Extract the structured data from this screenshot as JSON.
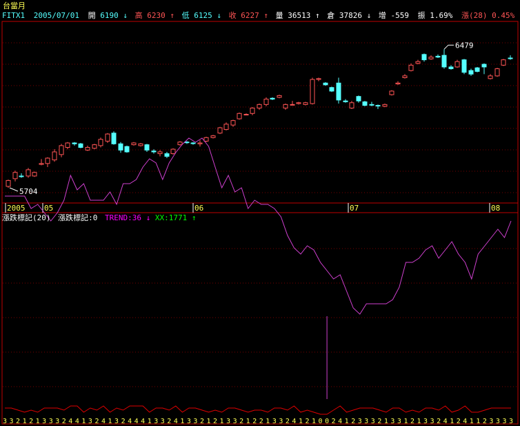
{
  "window": {
    "title": "台當月",
    "symbol": "FITX1",
    "date": "2005/07/01"
  },
  "quote": {
    "open_label": "開",
    "open": "6190",
    "open_arrow": "↓",
    "high_label": "高",
    "high": "6230",
    "high_arrow": "↑",
    "low_label": "低",
    "low": "6125",
    "low_arrow": "↓",
    "close_label": "收",
    "close": "6227",
    "close_arrow": "↑",
    "volume_label": "量",
    "volume": "36513",
    "volume_arrow": "↑",
    "oi_label": "倉",
    "oi": "37826",
    "oi_arrow": "↓",
    "change_label": "增",
    "change": "-559",
    "amp_label": "振",
    "amp": "1.69%",
    "rise_label": "漲(28)",
    "rise": "0.45%"
  },
  "indicator": {
    "name": "漲跌標記(20)",
    "name2": "漲跌標記:0",
    "trend_label": "TREND:36",
    "trend_arrow": "↓",
    "xx_label": "XX:1771",
    "xx_arrow": "↑"
  },
  "colors": {
    "background": "#000000",
    "up": "#ff5555",
    "down": "#55ffff",
    "panel_border": "#c00000",
    "grid": "#7a0000",
    "trend": "#d040d0",
    "spike": "#d040d0",
    "bottom_line": "#e00000",
    "xaxis_text": "#ffff55",
    "title_text": "#ffff55",
    "header_text": "#ffffff",
    "green": "#00ff00",
    "magenta": "#ff00ff"
  },
  "chart_data": [
    {
      "type": "candlestick",
      "title": "台當月",
      "x_tick_labels": [
        "2005",
        "05",
        "06",
        "07",
        "08"
      ],
      "annotations": [
        {
          "text": "5704",
          "value": 5704
        },
        {
          "text": "6479",
          "value": 6479
        }
      ],
      "ylim": [
        5650,
        6600
      ],
      "candles": [
        {
          "o": 5745,
          "c": 5712,
          "h": 5750,
          "l": 5704,
          "dir": "up"
        },
        {
          "o": 5755,
          "c": 5790,
          "h": 5800,
          "l": 5740,
          "dir": "up"
        },
        {
          "o": 5770,
          "c": 5770,
          "h": 5785,
          "l": 5760,
          "dir": "down"
        },
        {
          "o": 5770,
          "c": 5805,
          "h": 5815,
          "l": 5760,
          "dir": "up"
        },
        {
          "o": 5790,
          "c": 5770,
          "h": 5795,
          "l": 5765,
          "dir": "up"
        },
        {
          "o": 5840,
          "c": 5835,
          "h": 5865,
          "l": 5830,
          "dir": "up"
        },
        {
          "o": 5840,
          "c": 5870,
          "h": 5875,
          "l": 5820,
          "dir": "up"
        },
        {
          "o": 5860,
          "c": 5905,
          "h": 5920,
          "l": 5850,
          "dir": "up"
        },
        {
          "o": 5890,
          "c": 5940,
          "h": 5950,
          "l": 5875,
          "dir": "up"
        },
        {
          "o": 5930,
          "c": 5955,
          "h": 5960,
          "l": 5920,
          "dir": "up"
        },
        {
          "o": 5955,
          "c": 5950,
          "h": 5960,
          "l": 5940,
          "dir": "down"
        },
        {
          "o": 5950,
          "c": 5930,
          "h": 5955,
          "l": 5925,
          "dir": "down"
        },
        {
          "o": 5915,
          "c": 5930,
          "h": 5940,
          "l": 5910,
          "dir": "up"
        },
        {
          "o": 5925,
          "c": 5945,
          "h": 5950,
          "l": 5920,
          "dir": "up"
        },
        {
          "o": 5940,
          "c": 5975,
          "h": 5985,
          "l": 5930,
          "dir": "up"
        },
        {
          "o": 5965,
          "c": 6005,
          "h": 6010,
          "l": 5955,
          "dir": "up"
        },
        {
          "o": 6010,
          "c": 5950,
          "h": 6020,
          "l": 5945,
          "dir": "down"
        },
        {
          "o": 5950,
          "c": 5915,
          "h": 5960,
          "l": 5900,
          "dir": "down"
        },
        {
          "o": 5935,
          "c": 5905,
          "h": 5940,
          "l": 5900,
          "dir": "down"
        },
        {
          "o": 5955,
          "c": 5945,
          "h": 5960,
          "l": 5940,
          "dir": "up"
        },
        {
          "o": 5940,
          "c": 5950,
          "h": 5955,
          "l": 5935,
          "dir": "up"
        },
        {
          "o": 5945,
          "c": 5915,
          "h": 5950,
          "l": 5905,
          "dir": "down"
        },
        {
          "o": 5905,
          "c": 5910,
          "h": 5920,
          "l": 5895,
          "dir": "down"
        },
        {
          "o": 5905,
          "c": 5895,
          "h": 5915,
          "l": 5880,
          "dir": "up"
        },
        {
          "o": 5895,
          "c": 5880,
          "h": 5905,
          "l": 5870,
          "dir": "down"
        },
        {
          "o": 5895,
          "c": 5920,
          "h": 5925,
          "l": 5890,
          "dir": "up"
        },
        {
          "o": 5945,
          "c": 5960,
          "h": 5965,
          "l": 5940,
          "dir": "up"
        },
        {
          "o": 5960,
          "c": 5960,
          "h": 5965,
          "l": 5950,
          "dir": "down"
        },
        {
          "o": 5955,
          "c": 5955,
          "h": 5960,
          "l": 5945,
          "dir": "down"
        },
        {
          "o": 5950,
          "c": 5955,
          "h": 5970,
          "l": 5935,
          "dir": "up"
        },
        {
          "o": 5985,
          "c": 5965,
          "h": 5990,
          "l": 5960,
          "dir": "up"
        },
        {
          "o": 5995,
          "c": 5985,
          "h": 6000,
          "l": 5980,
          "dir": "up"
        },
        {
          "o": 6010,
          "c": 6040,
          "h": 6045,
          "l": 6005,
          "dir": "up"
        },
        {
          "o": 6030,
          "c": 6060,
          "h": 6070,
          "l": 6025,
          "dir": "up"
        },
        {
          "o": 6055,
          "c": 6080,
          "h": 6085,
          "l": 6045,
          "dir": "up"
        },
        {
          "o": 6090,
          "c": 6120,
          "h": 6125,
          "l": 6085,
          "dir": "up"
        },
        {
          "o": 6115,
          "c": 6115,
          "h": 6120,
          "l": 6110,
          "dir": "up"
        },
        {
          "o": 6120,
          "c": 6150,
          "h": 6155,
          "l": 6110,
          "dir": "up"
        },
        {
          "o": 6150,
          "c": 6170,
          "h": 6175,
          "l": 6140,
          "dir": "up"
        },
        {
          "o": 6170,
          "c": 6200,
          "h": 6210,
          "l": 6160,
          "dir": "up"
        },
        {
          "o": 6200,
          "c": 6205,
          "h": 6210,
          "l": 6195,
          "dir": "down"
        },
        {
          "o": 6220,
          "c": 6210,
          "h": 6225,
          "l": 6205,
          "dir": "up"
        },
        {
          "o": 6150,
          "c": 6170,
          "h": 6175,
          "l": 6140,
          "dir": "up"
        },
        {
          "o": 6170,
          "c": 6170,
          "h": 6190,
          "l": 6165,
          "dir": "up"
        },
        {
          "o": 6180,
          "c": 6175,
          "h": 6185,
          "l": 6170,
          "dir": "up"
        },
        {
          "o": 6170,
          "c": 6180,
          "h": 6185,
          "l": 6165,
          "dir": "up"
        },
        {
          "o": 6175,
          "c": 6310,
          "h": 6320,
          "l": 6170,
          "dir": "up"
        },
        {
          "o": 6310,
          "c": 6315,
          "h": 6320,
          "l": 6300,
          "dir": "up"
        },
        {
          "o": 6290,
          "c": 6280,
          "h": 6295,
          "l": 6275,
          "dir": "down"
        },
        {
          "o": 6265,
          "c": 6245,
          "h": 6270,
          "l": 6240,
          "dir": "down"
        },
        {
          "o": 6290,
          "c": 6195,
          "h": 6320,
          "l": 6175,
          "dir": "down"
        },
        {
          "o": 6190,
          "c": 6185,
          "h": 6200,
          "l": 6180,
          "dir": "down"
        },
        {
          "o": 6180,
          "c": 6150,
          "h": 6190,
          "l": 6145,
          "dir": "up"
        },
        {
          "o": 6215,
          "c": 6190,
          "h": 6220,
          "l": 6180,
          "dir": "down"
        },
        {
          "o": 6185,
          "c": 6165,
          "h": 6190,
          "l": 6160,
          "dir": "down"
        },
        {
          "o": 6170,
          "c": 6170,
          "h": 6185,
          "l": 6160,
          "dir": "down"
        },
        {
          "o": 6165,
          "c": 6165,
          "h": 6170,
          "l": 6145,
          "dir": "down"
        },
        {
          "o": 6160,
          "c": 6170,
          "h": 6175,
          "l": 6155,
          "dir": "up"
        },
        {
          "o": 6225,
          "c": 6245,
          "h": 6250,
          "l": 6220,
          "dir": "up"
        },
        {
          "o": 6285,
          "c": 6290,
          "h": 6300,
          "l": 6280,
          "dir": "up"
        },
        {
          "o": 6320,
          "c": 6330,
          "h": 6340,
          "l": 6315,
          "dir": "up"
        },
        {
          "o": 6360,
          "c": 6390,
          "h": 6400,
          "l": 6355,
          "dir": "up"
        },
        {
          "o": 6400,
          "c": 6410,
          "h": 6420,
          "l": 6395,
          "dir": "up"
        },
        {
          "o": 6450,
          "c": 6420,
          "h": 6455,
          "l": 6410,
          "dir": "down"
        },
        {
          "o": 6435,
          "c": 6425,
          "h": 6445,
          "l": 6420,
          "dir": "up"
        },
        {
          "o": 6440,
          "c": 6435,
          "h": 6450,
          "l": 6430,
          "dir": "down"
        },
        {
          "o": 6445,
          "c": 6380,
          "h": 6479,
          "l": 6370,
          "dir": "down"
        },
        {
          "o": 6380,
          "c": 6370,
          "h": 6390,
          "l": 6365,
          "dir": "down"
        },
        {
          "o": 6380,
          "c": 6410,
          "h": 6420,
          "l": 6375,
          "dir": "up"
        },
        {
          "o": 6420,
          "c": 6350,
          "h": 6425,
          "l": 6340,
          "dir": "down"
        },
        {
          "o": 6360,
          "c": 6340,
          "h": 6370,
          "l": 6330,
          "dir": "down"
        },
        {
          "o": 6375,
          "c": 6355,
          "h": 6380,
          "l": 6350,
          "dir": "down"
        },
        {
          "o": 6395,
          "c": 6380,
          "h": 6400,
          "l": 6340,
          "dir": "down"
        },
        {
          "o": 6330,
          "c": 6315,
          "h": 6340,
          "l": 6310,
          "dir": "up"
        },
        {
          "o": 6330,
          "c": 6370,
          "h": 6375,
          "l": 6325,
          "dir": "up"
        },
        {
          "o": 6390,
          "c": 6420,
          "h": 6425,
          "l": 6385,
          "dir": "up"
        },
        {
          "o": 6430,
          "c": 6430,
          "h": 6445,
          "l": 6420,
          "dir": "down"
        }
      ]
    },
    {
      "type": "line",
      "title": "漲跌標記(20)",
      "series": [
        {
          "name": "TREND",
          "values": [
            88,
            88,
            88,
            88,
            82,
            84,
            80,
            76,
            80,
            86,
            98,
            91,
            94,
            86,
            86,
            86,
            90,
            84,
            94,
            94,
            96,
            102,
            106,
            104,
            96,
            104,
            109,
            113,
            116,
            114,
            116,
            112,
            102,
            92,
            98,
            90,
            92,
            82,
            86,
            84,
            84,
            82,
            78,
            69,
            63,
            60,
            64,
            62,
            56,
            52,
            48,
            50,
            42,
            34,
            31,
            36,
            36,
            36,
            36,
            38,
            44,
            56,
            56,
            58,
            62,
            64,
            58,
            62,
            66,
            60,
            56,
            48,
            60,
            64,
            68,
            72,
            68,
            76
          ]
        },
        {
          "name": "XX",
          "values": [
            0,
            0,
            0,
            0,
            0,
            0,
            0,
            0,
            0,
            0,
            0,
            0,
            0,
            0,
            0,
            0,
            0,
            0,
            0,
            0,
            0,
            0,
            0,
            0,
            0,
            0,
            0,
            0,
            0,
            0,
            0,
            0,
            0,
            0,
            0,
            0,
            0,
            0,
            0,
            0,
            0,
            0,
            0,
            0,
            0,
            0,
            0,
            0,
            0,
            0,
            0,
            0,
            0,
            0,
            0,
            0,
            0,
            0,
            0,
            0,
            0,
            0,
            0,
            0,
            0,
            0,
            0,
            0,
            0,
            0,
            0,
            0,
            0,
            0,
            0,
            0,
            0,
            0
          ]
        },
        {
          "name": "漲跌標記",
          "values": [
            3,
            3,
            2,
            1,
            2,
            1,
            3,
            3,
            3,
            2,
            4,
            4,
            1,
            3,
            2,
            4,
            1,
            3,
            2,
            4,
            4,
            4,
            1,
            3,
            3,
            2,
            4,
            1,
            3,
            3,
            2,
            1,
            2,
            1,
            3,
            3,
            2,
            1,
            2,
            2,
            1,
            3,
            3,
            2,
            4,
            1,
            2,
            1,
            0,
            0,
            2,
            4,
            1,
            2,
            3,
            3,
            3,
            2,
            1,
            3,
            3,
            1,
            2,
            1,
            3,
            3,
            2,
            4,
            1,
            2,
            4,
            1,
            1,
            2,
            3,
            3,
            3,
            3
          ]
        }
      ],
      "bottom_labels": [
        "3",
        "3",
        "2",
        "1",
        "2",
        "1",
        "3",
        "3",
        "3",
        "2",
        "4",
        "4",
        "1",
        "3",
        "2",
        "4",
        "1",
        "3",
        "2",
        "4",
        "4",
        "4",
        "1",
        "3",
        "3",
        "2",
        "4",
        "1",
        "3",
        "3",
        "2",
        "1",
        "2",
        "1",
        "3",
        "3",
        "2",
        "1",
        "2",
        "2",
        "1",
        "3",
        "3",
        "2",
        "4",
        "1",
        "2",
        "1",
        "0",
        "0",
        "2",
        "4",
        "1",
        "2",
        "3",
        "3",
        "3",
        "2",
        "1",
        "3",
        "3",
        "1",
        "2",
        "1",
        "3",
        "3",
        "2",
        "4",
        "1",
        "2",
        "4",
        "1",
        "1",
        "2",
        "3",
        "3",
        "3",
        "3"
      ],
      "spike": {
        "index": 49,
        "value": -1771
      }
    }
  ]
}
